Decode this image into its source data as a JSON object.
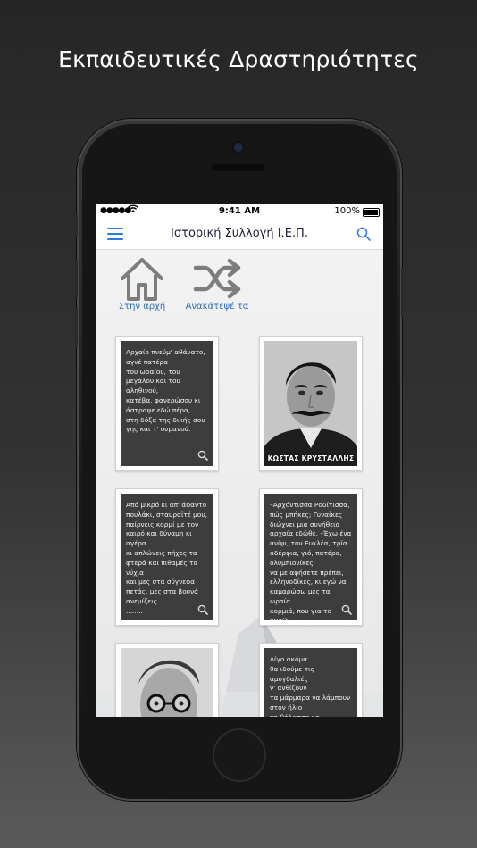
{
  "headline": "Εκπαιδευτικές Δραστηριότητες",
  "status_bar": {
    "signal": "●●●●●",
    "time": "9:41 AM",
    "battery": "100%"
  },
  "navbar": {
    "title": "Ιστορική Συλλογή Ι.Ε.Π."
  },
  "quick_actions": [
    {
      "label": "Στην αρχή",
      "icon": "home-icon"
    },
    {
      "label": "Ανακάτεψέ τα",
      "icon": "shuffle-icon"
    }
  ],
  "cards": [
    {
      "type": "text",
      "text": "Αρχαίο πνεύμ' αθάνατο,\nαγνέ πατέρα\nτου ωραίου, του\nμεγάλου και του\nαληθινού,\nκατέβα, φανερώσου κι\nάστραψε εδώ πέρα,\nστη δόξα της δικής σου\nγης και τ' ουρανού."
    },
    {
      "type": "photo",
      "caption": "ΚΩΣΤΑΣ ΚΡΥΣΤΑΛΛΗΣ"
    },
    {
      "type": "text",
      "text": "Από μικρό κι απ' άφαντο\nπουλάκι, σταυραϊτέ μου,\nπαίρνεις κορμί με τον\nκαιρό και δύναμη κι\nαγέρα\nκι απλώνεις πήχες τα\nφτερά και πιθαμές τα\nνύχια\nκαι μες στα σύγνεφα\nπετάς, μες στα βουνά\nανεμίζεις.\n........"
    },
    {
      "type": "text",
      "text": "–Αρχόντισσα Ροδίτισσα,\nπώς μπήκες; Γυναίκες\nδιώχνει μια συνήθεια\nαρχαία εδώθε. –Έχω ένα\nανίψι, τον Ευκλέα, τρία\nαδέρφια, γιό, πατέρα,\nολυμπιονίκες·\nνα με αφήσετε πρέπει,\nελληνοδίκες, κι εγώ να\nκαμαρώσω μες τα ωραία\nκορμιά, που για το αγρίλι\nτου Ηρακλέα παλεύουν."
    },
    {
      "type": "photo",
      "caption": ""
    },
    {
      "type": "text",
      "text": "Λίγο ακόμα\nθα ιδούμε τις αμυγδαλιές\nν' ανθίζουν\nτα μάρμαρα να λάμπουν\nστον ήλιο\nτη θάλασσα να κυματίζει"
    }
  ],
  "colors": {
    "accent": "#2c7be5",
    "card_dark": "#3d3d3d",
    "icon_gray": "#7d7d7d"
  }
}
